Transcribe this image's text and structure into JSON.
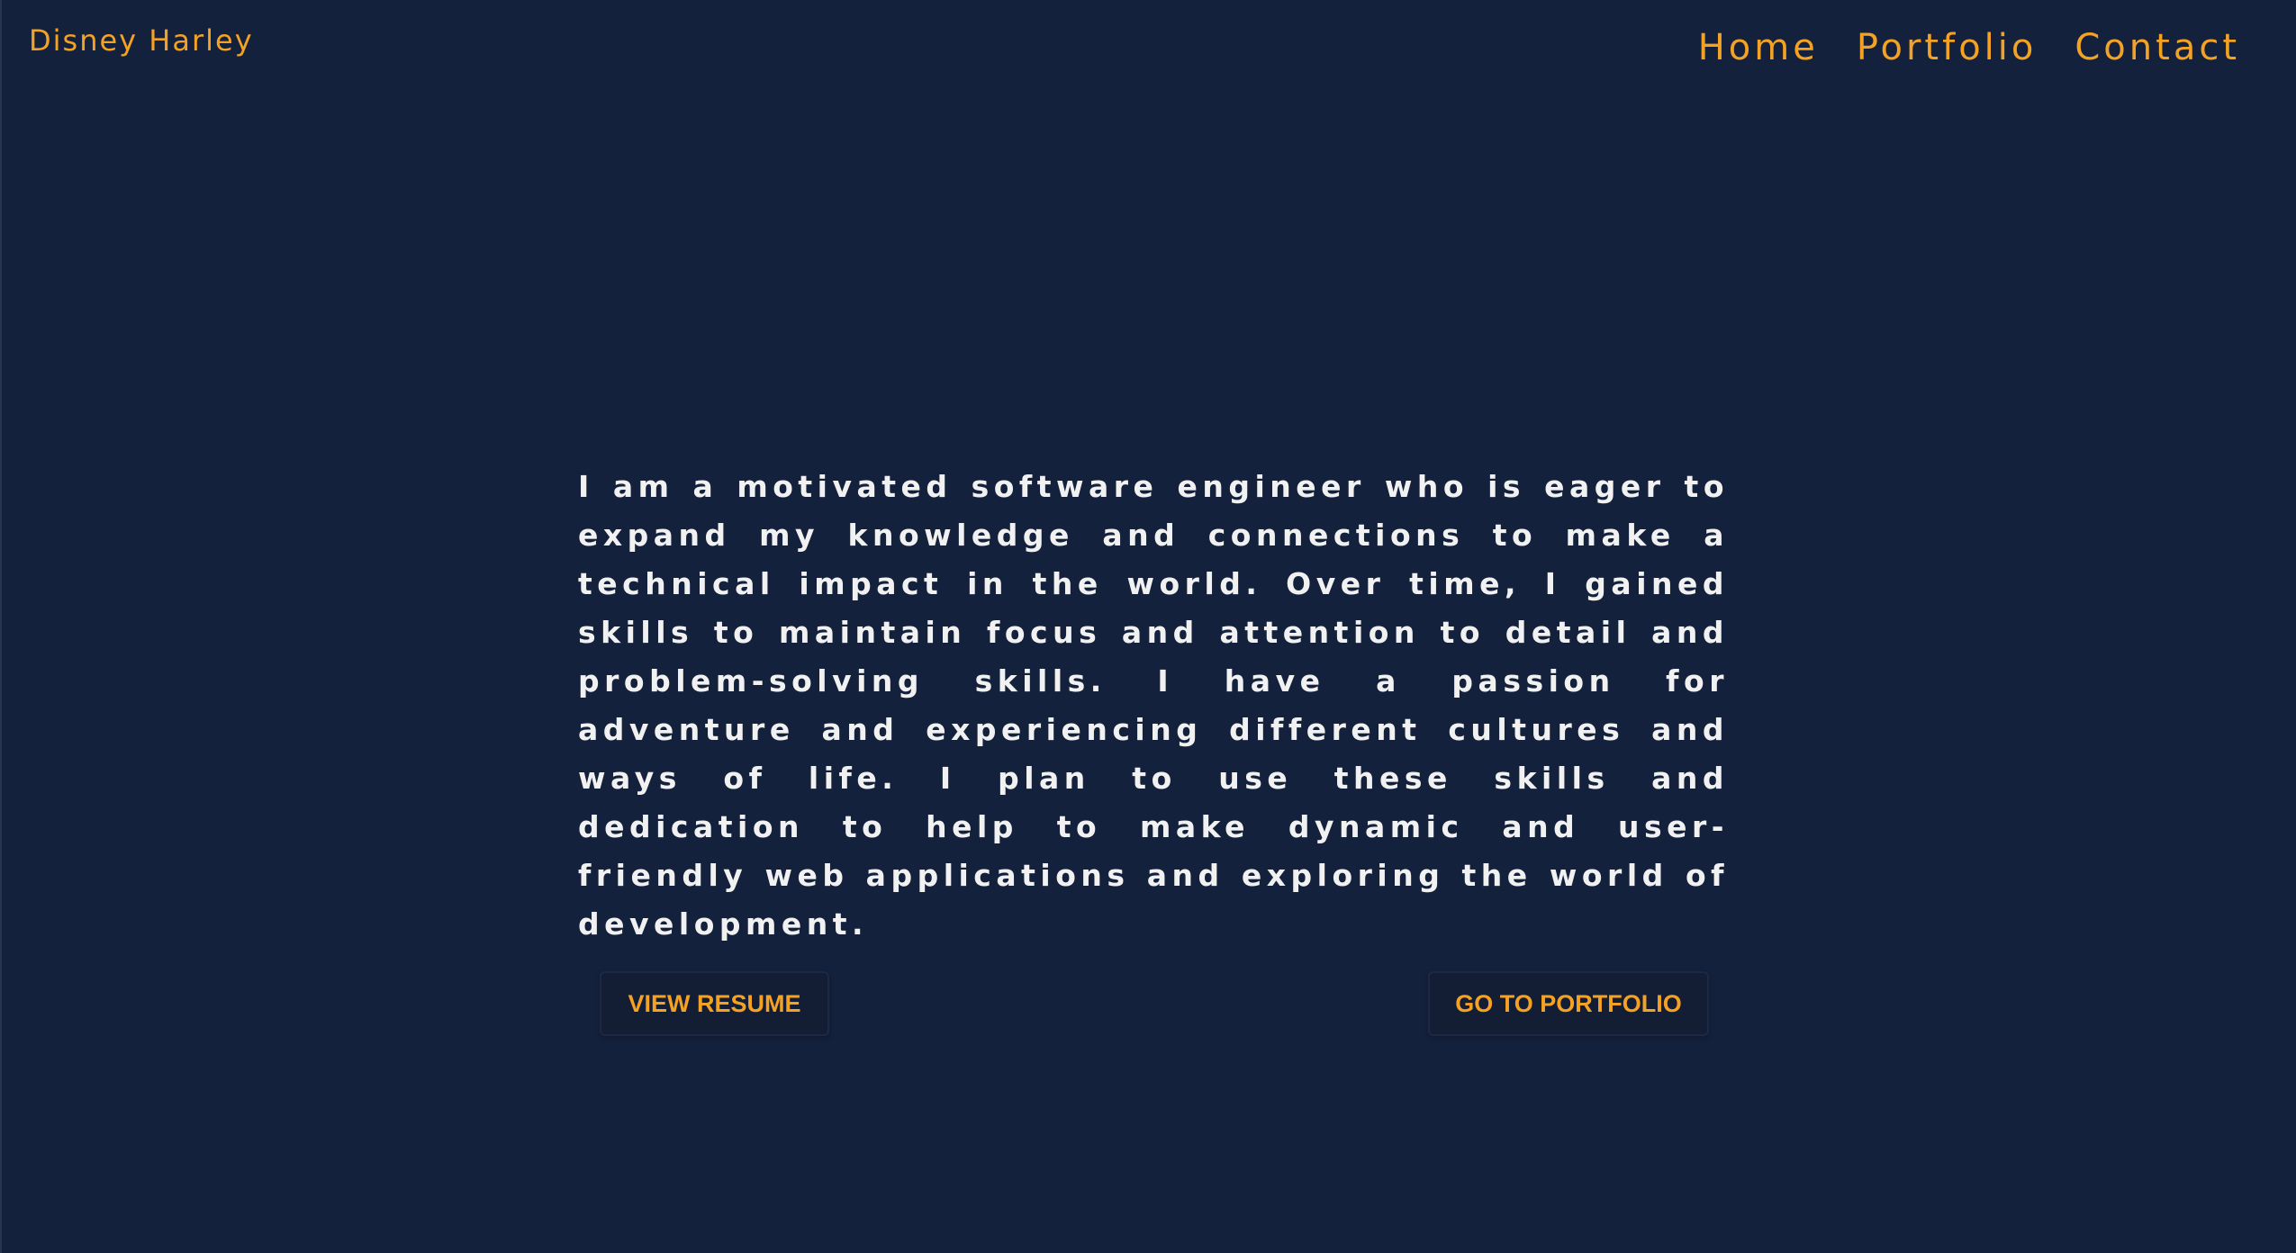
{
  "header": {
    "brand": "Disney Harley",
    "nav": [
      {
        "label": "Home"
      },
      {
        "label": "Portfolio"
      },
      {
        "label": "Contact"
      }
    ]
  },
  "main": {
    "bio": "I am a motivated software engineer who is eager to expand my knowledge and connections to make a technical impact in the world. Over time, I gained skills to maintain focus and attention to detail and problem-solving skills. I have a passion for adventure and experiencing different cultures and ways of life. I plan to use these skills and dedication to help to make dynamic and user-friendly web applications and exploring the world of development.",
    "buttons": {
      "resume": "VIEW RESUME",
      "portfolio": "GO TO PORTFOLIO"
    }
  },
  "colors": {
    "background": "#14213d",
    "accent": "#f4a224",
    "text": "#f1f1f1"
  }
}
